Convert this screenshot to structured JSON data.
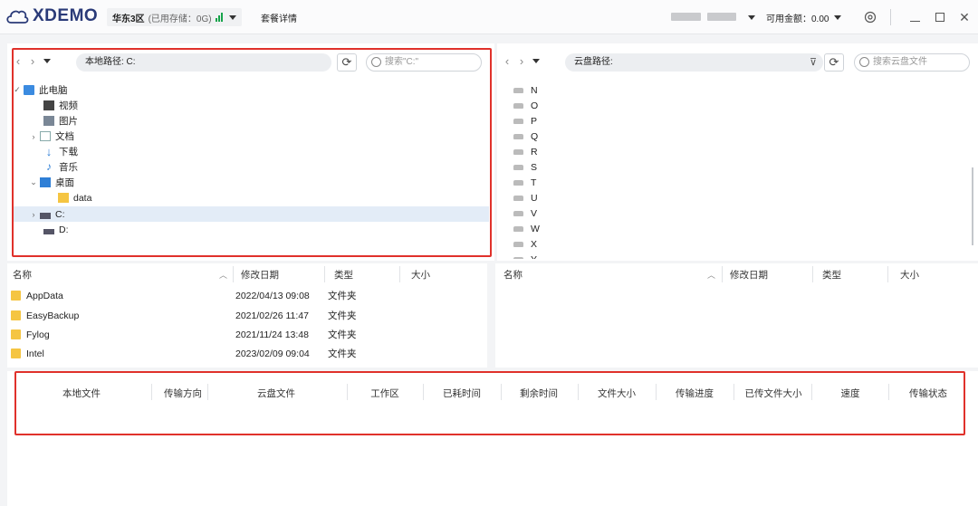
{
  "app": {
    "logo": "XDEMO"
  },
  "region": {
    "name": "华东3区",
    "storage": "(已用存储：0G)"
  },
  "header": {
    "package_details": "套餐详情",
    "balance": "可用金额：0.00"
  },
  "local": {
    "path_label": "本地路径: C:",
    "search_placeholder": "搜索\"C:\"",
    "tree": [
      {
        "label": "此电脑"
      },
      {
        "label": "视频"
      },
      {
        "label": "图片"
      },
      {
        "label": "文档"
      },
      {
        "label": "下载"
      },
      {
        "label": "音乐"
      },
      {
        "label": "桌面"
      },
      {
        "label": "data"
      },
      {
        "label": "C:"
      },
      {
        "label": "D:"
      }
    ],
    "columns": {
      "name": "名称",
      "modified": "修改日期",
      "type": "类型",
      "size": "大小"
    },
    "files": [
      {
        "name": "AppData",
        "modified": "2022/04/13 09:08",
        "type": "文件夹"
      },
      {
        "name": "EasyBackup",
        "modified": "2021/02/26 11:47",
        "type": "文件夹"
      },
      {
        "name": "Fylog",
        "modified": "2021/11/24 13:48",
        "type": "文件夹"
      },
      {
        "name": "Intel",
        "modified": "2023/02/09 09:04",
        "type": "文件夹"
      }
    ]
  },
  "cloud": {
    "path_label": "云盘路径:",
    "search_placeholder": "搜索云盘文件",
    "drives": [
      "N",
      "O",
      "P",
      "Q",
      "R",
      "S",
      "T",
      "U",
      "V",
      "W",
      "X",
      "Y"
    ],
    "columns": {
      "name": "名称",
      "modified": "修改日期",
      "type": "类型",
      "size": "大小"
    }
  },
  "transfer": {
    "columns": [
      "本地文件",
      "传输方向",
      "云盘文件",
      "工作区",
      "已耗时间",
      "剩余时间",
      "文件大小",
      "传输进度",
      "已传文件大小",
      "速度",
      "传输状态"
    ]
  },
  "colors": {
    "accent": "#2a3a78",
    "highlight": "#e3ecf7",
    "red_box": "#e0312b",
    "signal": "#16a34a"
  }
}
